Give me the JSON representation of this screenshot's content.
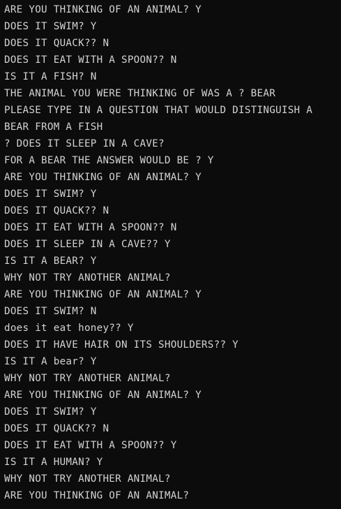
{
  "terminal": {
    "lines": [
      "ARE YOU THINKING OF AN ANIMAL? Y",
      "DOES IT SWIM? Y",
      "DOES IT QUACK?? N",
      "DOES IT EAT WITH A SPOON?? N",
      "IS IT A FISH? N",
      "THE ANIMAL YOU WERE THINKING OF WAS A ? BEAR",
      "PLEASE TYPE IN A QUESTION THAT WOULD DISTINGUISH A",
      "BEAR FROM A FISH",
      "? DOES IT SLEEP IN A CAVE?",
      "FOR A BEAR THE ANSWER WOULD BE ? Y",
      "ARE YOU THINKING OF AN ANIMAL? Y",
      "DOES IT SWIM? Y",
      "DOES IT QUACK?? N",
      "DOES IT EAT WITH A SPOON?? N",
      "DOES IT SLEEP IN A CAVE?? Y",
      "IS IT A BEAR? Y",
      "WHY NOT TRY ANOTHER ANIMAL?",
      "ARE YOU THINKING OF AN ANIMAL? Y",
      "DOES IT SWIM? N",
      "does it eat honey?? Y",
      "DOES IT HAVE HAIR ON ITS SHOULDERS?? Y",
      "IS IT A bear? Y",
      "WHY NOT TRY ANOTHER ANIMAL?",
      "ARE YOU THINKING OF AN ANIMAL? Y",
      "DOES IT SWIM? Y",
      "DOES IT QUACK?? N",
      "DOES IT EAT WITH A SPOON?? Y",
      "IS IT A HUMAN? Y",
      "WHY NOT TRY ANOTHER ANIMAL?",
      "ARE YOU THINKING OF AN ANIMAL?"
    ]
  },
  "colors": {
    "background": "#0c0c0c",
    "text": "#d4d4d4"
  }
}
